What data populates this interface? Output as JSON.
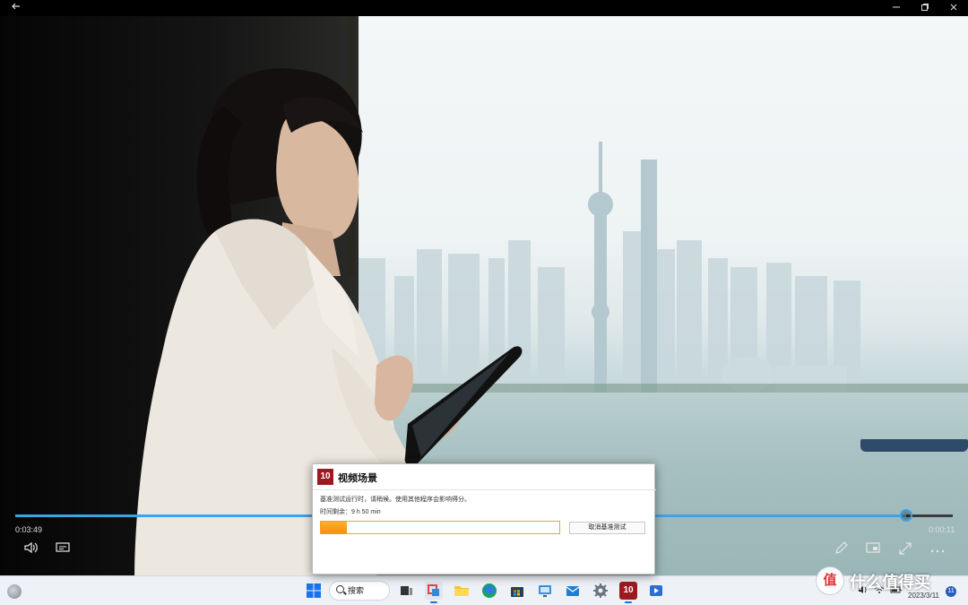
{
  "window": {
    "back_icon": "arrow-left-icon",
    "minimize_icon": "minimize-icon",
    "restore_icon": "restore-icon",
    "close_icon": "close-icon"
  },
  "player": {
    "elapsed": "0:03:49",
    "remaining": "0:00:11",
    "progress": 0.95,
    "accent": "#3fa1e6"
  },
  "dialog": {
    "logo_text": "10",
    "title": "视频场景",
    "message": "基准测试运行时，请稍候。使用其他程序会影响得分。",
    "remaining_label": "时间剩余：9 h 50 min",
    "progress": 0.11,
    "cancel_label": "取消基准测试",
    "accent": "#f09010"
  },
  "taskbar": {
    "search_label": "搜索",
    "date": "2023/3/11",
    "notification_count": "11"
  },
  "watermark": {
    "logo": "值",
    "text": "什么值得买"
  }
}
